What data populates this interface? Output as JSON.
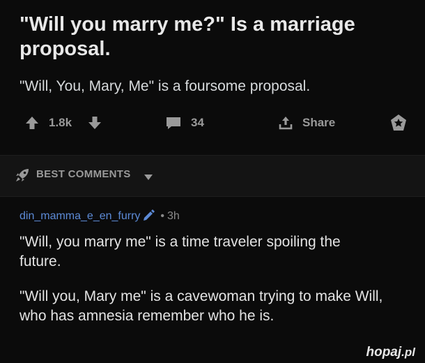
{
  "post": {
    "title": "\"Will you marry me?\" Is a marriage proposal.",
    "body": "\"Will, You, Mary, Me\" is a foursome proposal."
  },
  "actions": {
    "score": "1.8k",
    "comment_count": "34",
    "share_label": "Share"
  },
  "comments_bar": {
    "label": "BEST COMMENTS"
  },
  "comment": {
    "username": "din_mamma_e_en_furry",
    "separator": "•",
    "age": "3h",
    "paragraphs": [
      "\"Will, you marry me\" is a time traveler spoiling the future.",
      "\"Will you, Mary me\" is a cavewoman trying to make Will, who has amnesia remember who he is."
    ]
  },
  "watermark": {
    "brand": "hopaj",
    "tld": ".pl"
  },
  "colors": {
    "background": "#0b0b0b",
    "username": "#5c8ad6",
    "icon": "#9a9a9a"
  },
  "icons": [
    "upvote-icon",
    "downvote-icon",
    "comment-icon",
    "share-icon",
    "award-icon",
    "rocket-icon",
    "caret-down-icon",
    "edit-flair-icon"
  ]
}
